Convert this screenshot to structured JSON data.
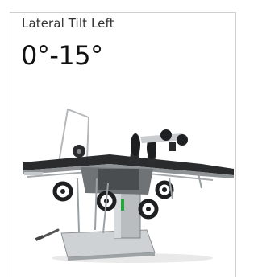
{
  "card": {
    "label": "Lateral Tilt Left",
    "value": "0°-15°"
  },
  "product_image": {
    "icon": "operating-table-illustration"
  }
}
